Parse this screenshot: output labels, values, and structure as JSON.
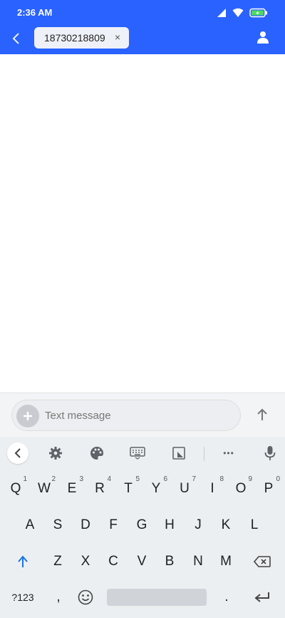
{
  "status_bar": {
    "time": "2:36 AM"
  },
  "header": {
    "recipient": "18730218809",
    "remove_symbol": "×"
  },
  "compose": {
    "placeholder": "Text message"
  },
  "keyboard": {
    "row1": [
      {
        "label": "Q",
        "hint": "1"
      },
      {
        "label": "W",
        "hint": "2"
      },
      {
        "label": "E",
        "hint": "3"
      },
      {
        "label": "R",
        "hint": "4"
      },
      {
        "label": "T",
        "hint": "5"
      },
      {
        "label": "Y",
        "hint": "6"
      },
      {
        "label": "U",
        "hint": "7"
      },
      {
        "label": "I",
        "hint": "8"
      },
      {
        "label": "O",
        "hint": "9"
      },
      {
        "label": "P",
        "hint": "0"
      }
    ],
    "row2": [
      "A",
      "S",
      "D",
      "F",
      "G",
      "H",
      "J",
      "K",
      "L"
    ],
    "row3": [
      "Z",
      "X",
      "C",
      "V",
      "B",
      "N",
      "M"
    ],
    "symbols_key": "?123",
    "comma_key": ",",
    "period_key": ".",
    "toolbar_more": "•••"
  },
  "colors": {
    "header_bg": "#2962ff",
    "keyboard_bg": "#eceff1",
    "shift_blue": "#1a73e8"
  }
}
